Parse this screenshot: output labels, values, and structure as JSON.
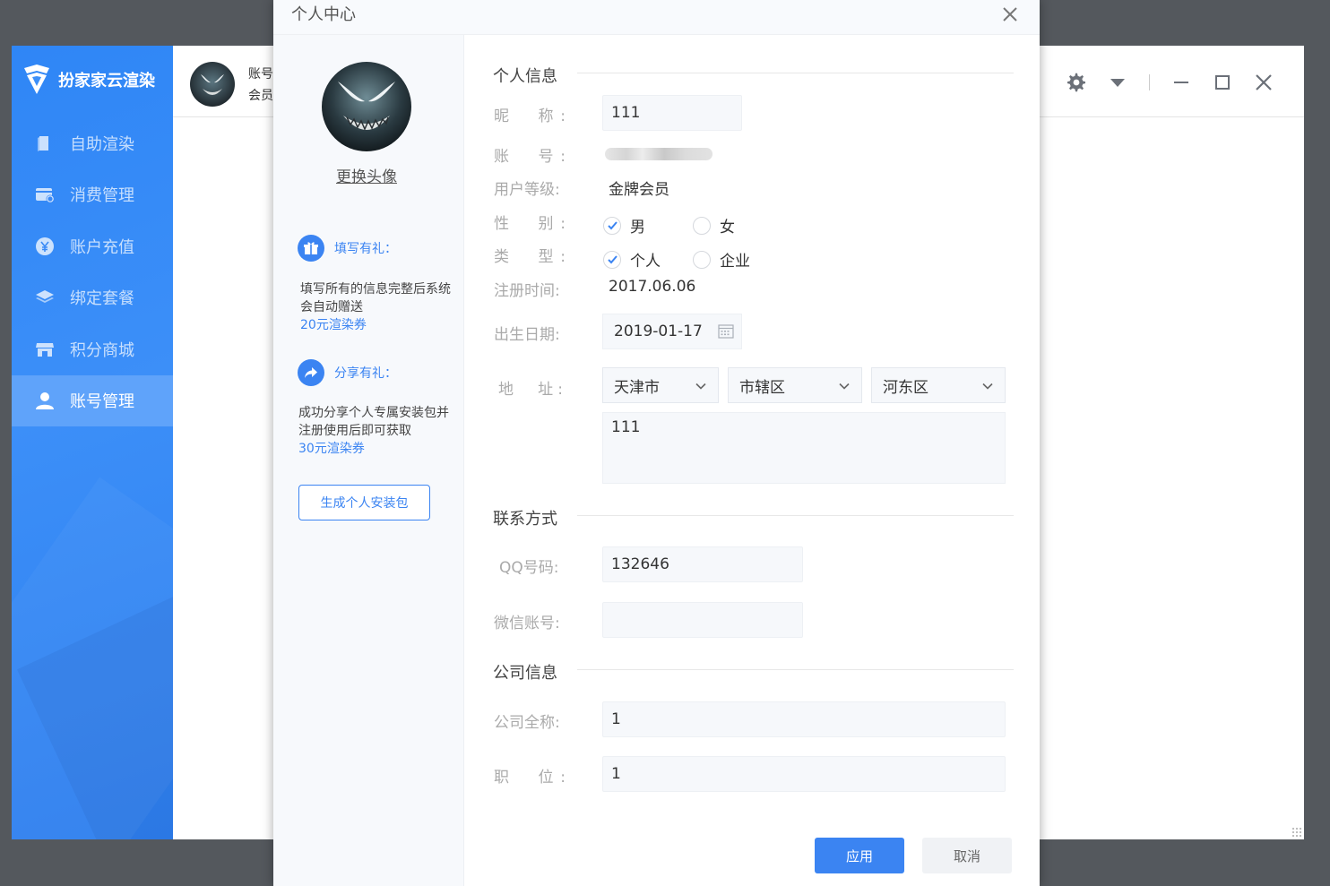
{
  "app": {
    "brand": "扮家家云渲染",
    "menu": [
      {
        "label": "自助渲染",
        "icon": "document-icon"
      },
      {
        "label": "消费管理",
        "icon": "wallet-icon"
      },
      {
        "label": "账户充值",
        "icon": "yen-coin-icon"
      },
      {
        "label": "绑定套餐",
        "icon": "layers-icon"
      },
      {
        "label": "积分商城",
        "icon": "store-icon"
      },
      {
        "label": "账号管理",
        "icon": "user-icon",
        "active": true
      }
    ],
    "header": {
      "account_line1": "账号",
      "account_line2": "会员"
    }
  },
  "modal": {
    "title": "个人中心",
    "left": {
      "change_avatar": "更换头像",
      "gift1_title": "填写有礼：",
      "gift1_desc": "填写所有的信息完整后系统会自动赠送",
      "gift1_highlight": "20元渲染券",
      "gift2_title": "分享有礼：",
      "gift2_desc": "成功分享个人专属安装包并注册使用后即可获取",
      "gift2_highlight": "30元渲染券",
      "generate_button": "生成个人安装包"
    },
    "personal": {
      "section": "个人信息",
      "nickname_label": "昵　称:",
      "nickname": "111",
      "account_label": "账　号:",
      "level_label": "用户等级:",
      "level": "金牌会员",
      "gender_label": "性　别:",
      "gender_options": [
        "男",
        "女"
      ],
      "gender_selected": "男",
      "type_label": "类　型:",
      "type_options": [
        "个人",
        "企业"
      ],
      "type_selected": "个人",
      "register_label": "注册时间:",
      "register_date": "2017.06.06",
      "birth_label": "出生日期:",
      "birth_date": "2019-01-17",
      "address_label": "地　址:",
      "province": "天津市",
      "city": "市辖区",
      "district": "河东区",
      "address_detail": "111"
    },
    "contact": {
      "section": "联系方式",
      "qq_label": "QQ号码:",
      "qq": "132646",
      "wechat_label": "微信账号:",
      "wechat": ""
    },
    "company": {
      "section": "公司信息",
      "name_label": "公司全称:",
      "name": "1",
      "position_label": "职　位:",
      "position": "1"
    },
    "buttons": {
      "apply": "应用",
      "cancel": "取消"
    }
  },
  "colors": {
    "accent": "#3b84f2",
    "sidebar": "#2f86f6",
    "sidebar_active": "#5fa3fa",
    "backdrop": "#54585d"
  }
}
